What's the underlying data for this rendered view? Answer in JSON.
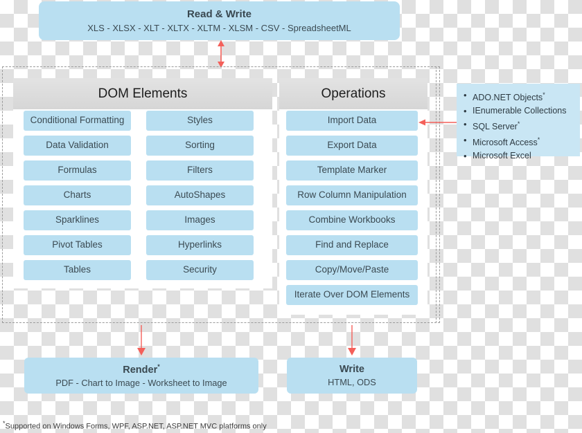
{
  "top_box": {
    "title": "Read & Write",
    "subtitle": "XLS - XLSX - XLT - XLTX - XLTM - XLSM - CSV -  SpreadsheetML"
  },
  "panels": {
    "dom": {
      "header": "DOM Elements",
      "left_column": [
        "Conditional Formatting",
        "Data Validation",
        "Formulas",
        "Charts",
        "Sparklines",
        "Pivot Tables",
        "Tables"
      ],
      "right_column": [
        "Styles",
        "Sorting",
        "Filters",
        "AutoShapes",
        "Images",
        "Hyperlinks",
        "Security"
      ]
    },
    "operations": {
      "header": "Operations",
      "items": [
        "Import Data",
        "Export Data",
        "Template Marker",
        "Row Column Manipulation",
        "Combine Workbooks",
        "Find and Replace",
        "Copy/Move/Paste",
        "Iterate Over DOM Elements"
      ]
    }
  },
  "data_sources": {
    "items": [
      {
        "label": "ADO.NET Objects",
        "starred": true
      },
      {
        "label": "IEnumerable Collections",
        "starred": false
      },
      {
        "label": "SQL Server",
        "starred": true
      },
      {
        "label": "Microsoft Access",
        "starred": true
      },
      {
        "label": "Microsoft Excel",
        "starred": false
      }
    ]
  },
  "bottom_boxes": {
    "render": {
      "title": "Render",
      "starred": true,
      "subtitle": "PDF - Chart to Image - Worksheet to Image"
    },
    "write": {
      "title": "Write",
      "starred": false,
      "subtitle": "HTML, ODS"
    }
  },
  "footnote": "Supported on Windows Forms, WPF, ASP.NET, ASP.NET MVC platforms only",
  "colors": {
    "chip_blue": "#b9dff1",
    "sources_blue": "#c9e6f4",
    "panel_header_gray": "#dcdcdc",
    "arrow_red": "#f4605a",
    "text_dark": "#3b4a52"
  }
}
